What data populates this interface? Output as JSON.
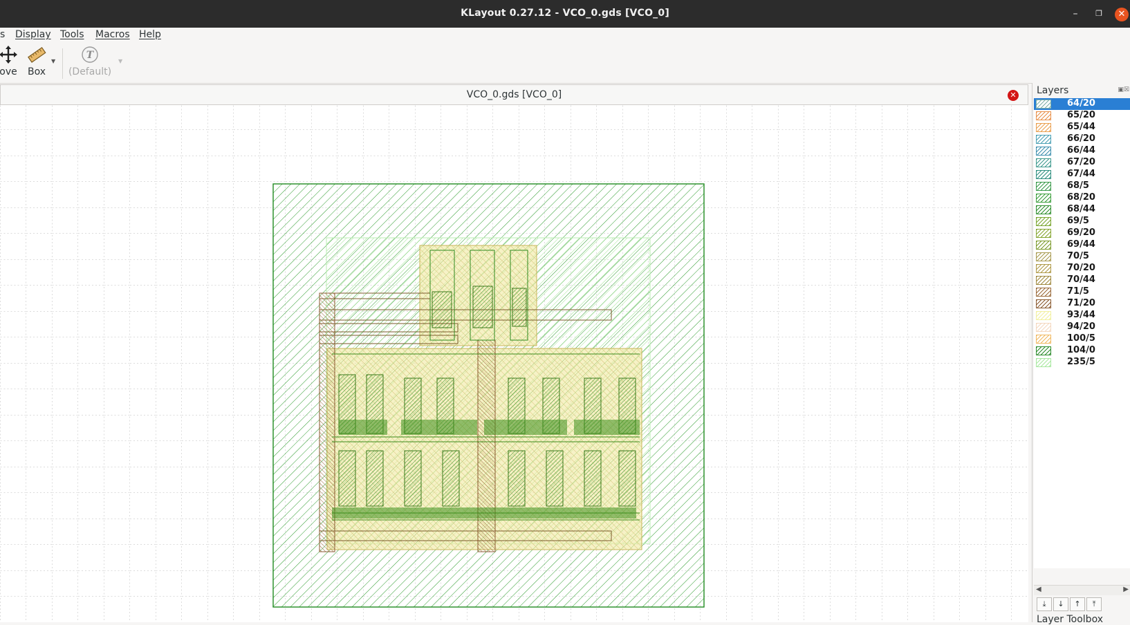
{
  "window": {
    "title": "KLayout 0.27.12 - VCO_0.gds [VCO_0]"
  },
  "menu": {
    "items": [
      {
        "label": "s"
      },
      {
        "label": "Display"
      },
      {
        "label": "Tools"
      },
      {
        "label": "Macros"
      },
      {
        "label": "Help"
      }
    ]
  },
  "toolbar": {
    "move_label": "ove",
    "box_label": "Box",
    "text_label": "(Default)",
    "text_icon": "T"
  },
  "layout_tab": {
    "title": "VCO_0.gds [VCO_0]"
  },
  "layers_panel": {
    "title": "Layers",
    "footer_title": "Layer Toolbox",
    "selected": "64/20",
    "layers": [
      {
        "name": "64/20",
        "color": "#7fb0a8"
      },
      {
        "name": "65/20",
        "color": "#e8904a"
      },
      {
        "name": "65/44",
        "color": "#eaa050"
      },
      {
        "name": "66/20",
        "color": "#4aa0b4"
      },
      {
        "name": "66/44",
        "color": "#3d8fae"
      },
      {
        "name": "67/20",
        "color": "#3f9a8e"
      },
      {
        "name": "67/44",
        "color": "#2f8f80"
      },
      {
        "name": "68/5",
        "color": "#3a9a4a"
      },
      {
        "name": "68/20",
        "color": "#3a9e3a"
      },
      {
        "name": "68/44",
        "color": "#2e8e2e"
      },
      {
        "name": "69/5",
        "color": "#7aa630"
      },
      {
        "name": "69/20",
        "color": "#86a632"
      },
      {
        "name": "69/44",
        "color": "#7c9a2c"
      },
      {
        "name": "70/5",
        "color": "#a89a50"
      },
      {
        "name": "70/20",
        "color": "#b09a48"
      },
      {
        "name": "70/44",
        "color": "#a08a40"
      },
      {
        "name": "71/5",
        "color": "#9a6a3a"
      },
      {
        "name": "71/20",
        "color": "#8a5a30"
      },
      {
        "name": "93/44",
        "color": "#f2f0a0"
      },
      {
        "name": "94/20",
        "color": "#f4d8c0"
      },
      {
        "name": "100/5",
        "color": "#f0b860"
      },
      {
        "name": "104/0",
        "color": "#2a8a2a"
      },
      {
        "name": "235/5",
        "color": "#a8e8a0"
      }
    ]
  }
}
